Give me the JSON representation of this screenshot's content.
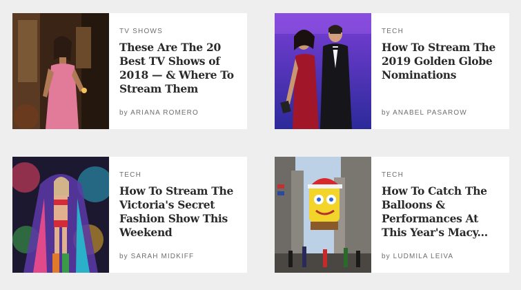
{
  "articles": [
    {
      "category": "TV SHOWS",
      "title": "These Are The 20 Best TV Shows of 2018 — & Where To Stream Them",
      "byline_prefix": "by",
      "author": "ARIANA ROMERO"
    },
    {
      "category": "TECH",
      "title": "How To Stream The 2019 Golden Globe Nominations",
      "byline_prefix": "by",
      "author": "ANABEL PASAROW"
    },
    {
      "category": "TECH",
      "title": "How To Stream The Victoria's Secret Fashion Show This Weekend",
      "byline_prefix": "by",
      "author": "SARAH MIDKIFF"
    },
    {
      "category": "TECH",
      "title": "How To Catch The Balloons & Performances At This Year's Macy...",
      "byline_prefix": "by",
      "author": "LUDMILA LEIVA"
    }
  ],
  "colors": {
    "page_background": "#eeeeee",
    "card_background": "#ffffff",
    "headline": "#2a2a2a",
    "meta": "#6e6e6e"
  }
}
